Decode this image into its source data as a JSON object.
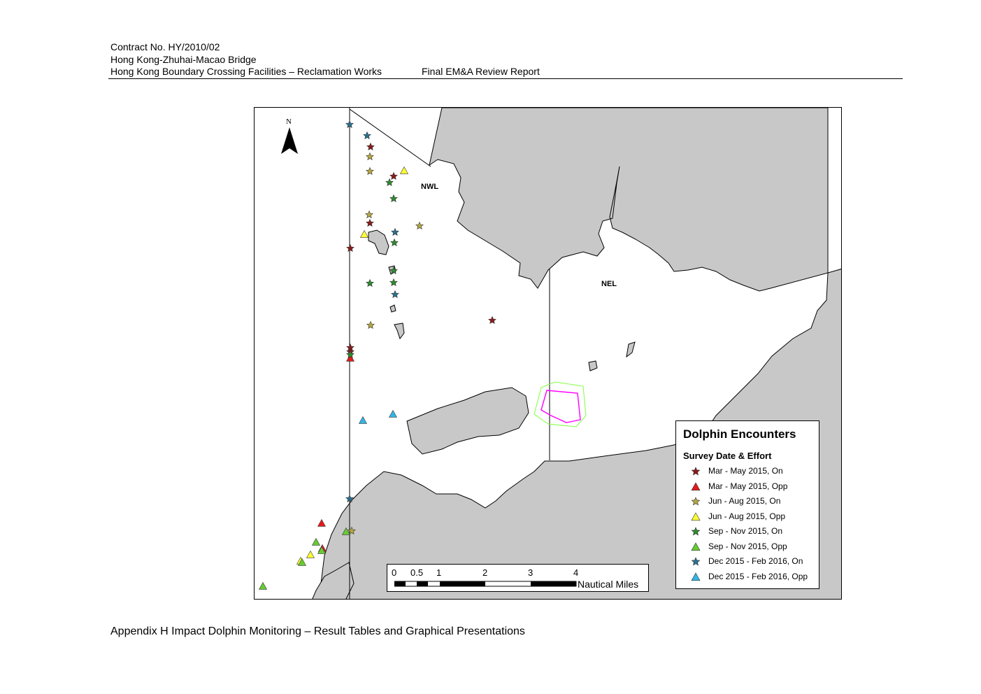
{
  "header": {
    "contract": "Contract No. HY/2010/02",
    "project": "Hong Kong-Zhuhai-Macao Bridge",
    "facility": "Hong Kong Boundary Crossing Facilities – Reclamation Works",
    "report": "Final EM&A Review Report"
  },
  "map": {
    "area_labels": [
      "NWL",
      "NEL"
    ],
    "north_label": "N",
    "colors": {
      "land": "#c8c8c8",
      "sea": "#ffffff",
      "outline": "#000000",
      "works_green": "#7fff3f",
      "works_pink": "#ff00ff"
    },
    "legend": {
      "title": "Dolphin Encounters",
      "subtitle": "Survey Date & Effort",
      "items": [
        {
          "label": "Mar - May 2015, On",
          "symbol": "star",
          "color": "#8b1a1a"
        },
        {
          "label": "Mar - May 2015, Opp",
          "symbol": "triangle",
          "color": "#e31a1c"
        },
        {
          "label": "Jun - Aug 2015, On",
          "symbol": "star",
          "color": "#b5a642"
        },
        {
          "label": "Jun - Aug 2015, Opp",
          "symbol": "triangle",
          "color": "#ffff33"
        },
        {
          "label": "Sep - Nov 2015, On",
          "symbol": "star",
          "color": "#2e8b2e"
        },
        {
          "label": "Sep - Nov 2015, Opp",
          "symbol": "triangle",
          "color": "#66cc33"
        },
        {
          "label": "Dec 2015 - Feb 2016, On",
          "symbol": "star",
          "color": "#2a7090"
        },
        {
          "label": "Dec 2015 - Feb 2016, Opp",
          "symbol": "triangle",
          "color": "#33b5e5"
        }
      ]
    },
    "scale_bar": {
      "ticks": [
        "0",
        "0.5",
        "1",
        "2",
        "3",
        "4"
      ],
      "units": "Nautical Miles"
    }
  },
  "footer": "Appendix H Impact Dolphin Monitoring – Result Tables and Graphical Presentations"
}
